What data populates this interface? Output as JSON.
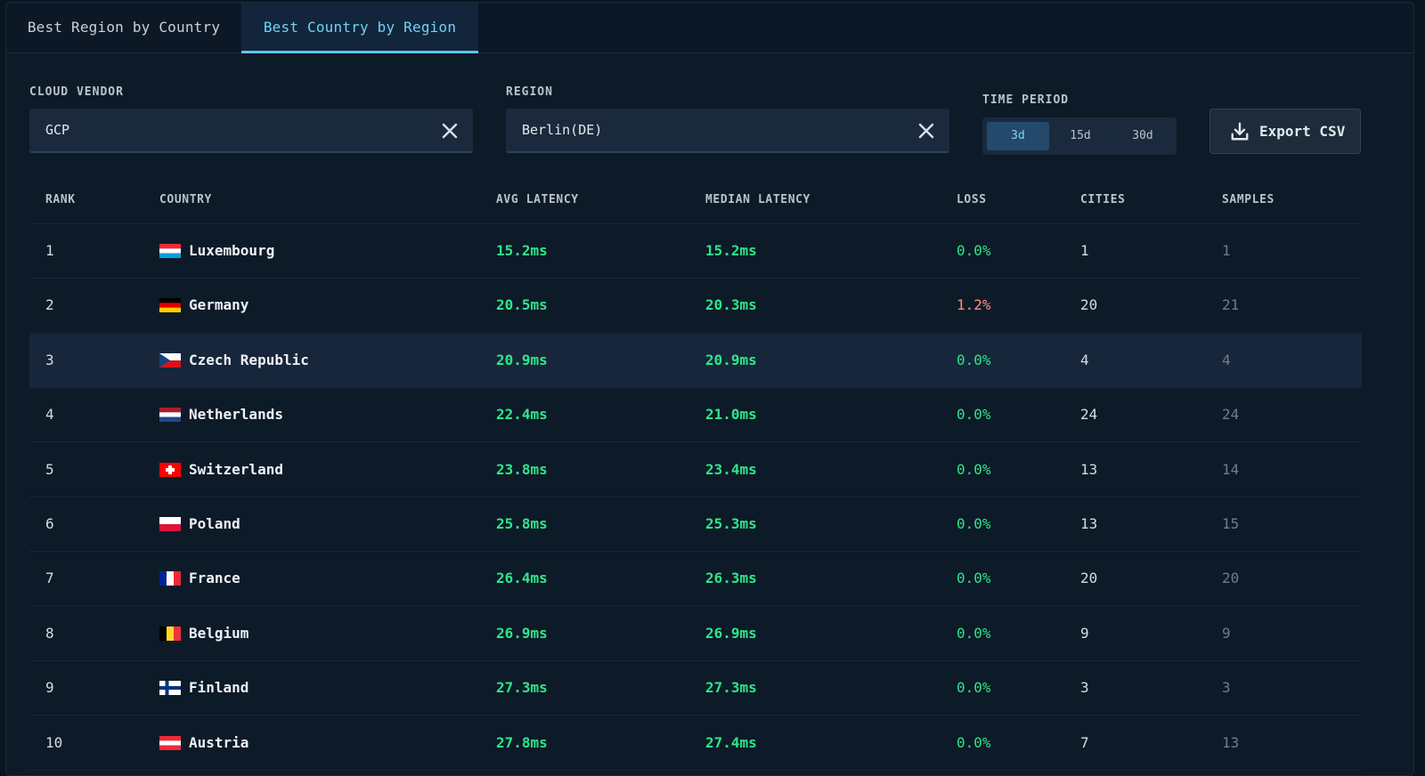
{
  "tabs": [
    {
      "label": "Best Region by Country",
      "active": false
    },
    {
      "label": "Best Country by Region",
      "active": true
    }
  ],
  "filters": {
    "cloud_vendor": {
      "label": "CLOUD VENDOR",
      "value": "GCP"
    },
    "region": {
      "label": "REGION",
      "value": "Berlin(DE)"
    },
    "time_period": {
      "label": "TIME PERIOD",
      "options": [
        "3d",
        "15d",
        "30d"
      ],
      "selected": "3d"
    }
  },
  "export_label": "Export CSV",
  "table": {
    "headers": {
      "rank": "RANK",
      "country": "COUNTRY",
      "avg_latency": "AVG LATENCY",
      "median_latency": "MEDIAN LATENCY",
      "loss": "LOSS",
      "cities": "CITIES",
      "samples": "SAMPLES"
    },
    "rows": [
      {
        "rank": "1",
        "country": "Luxembourg",
        "flag": "lu",
        "avg": "15.2ms",
        "median": "15.2ms",
        "loss": "0.0%",
        "cities": "1",
        "samples": "1"
      },
      {
        "rank": "2",
        "country": "Germany",
        "flag": "de",
        "avg": "20.5ms",
        "median": "20.3ms",
        "loss": "1.2%",
        "cities": "20",
        "samples": "21"
      },
      {
        "rank": "3",
        "country": "Czech Republic",
        "flag": "cz",
        "avg": "20.9ms",
        "median": "20.9ms",
        "loss": "0.0%",
        "cities": "4",
        "samples": "4"
      },
      {
        "rank": "4",
        "country": "Netherlands",
        "flag": "nl",
        "avg": "22.4ms",
        "median": "21.0ms",
        "loss": "0.0%",
        "cities": "24",
        "samples": "24"
      },
      {
        "rank": "5",
        "country": "Switzerland",
        "flag": "ch",
        "avg": "23.8ms",
        "median": "23.4ms",
        "loss": "0.0%",
        "cities": "13",
        "samples": "14"
      },
      {
        "rank": "6",
        "country": "Poland",
        "flag": "pl",
        "avg": "25.8ms",
        "median": "25.3ms",
        "loss": "0.0%",
        "cities": "13",
        "samples": "15"
      },
      {
        "rank": "7",
        "country": "France",
        "flag": "fr",
        "avg": "26.4ms",
        "median": "26.3ms",
        "loss": "0.0%",
        "cities": "20",
        "samples": "20"
      },
      {
        "rank": "8",
        "country": "Belgium",
        "flag": "be",
        "avg": "26.9ms",
        "median": "26.9ms",
        "loss": "0.0%",
        "cities": "9",
        "samples": "9"
      },
      {
        "rank": "9",
        "country": "Finland",
        "flag": "fi",
        "avg": "27.3ms",
        "median": "27.3ms",
        "loss": "0.0%",
        "cities": "3",
        "samples": "3"
      },
      {
        "rank": "10",
        "country": "Austria",
        "flag": "at",
        "avg": "27.8ms",
        "median": "27.4ms",
        "loss": "0.0%",
        "cities": "7",
        "samples": "13"
      }
    ]
  },
  "colors": {
    "good": "#2ee68a",
    "bad": "#ff8f7a",
    "accent": "#5ec6ef"
  }
}
